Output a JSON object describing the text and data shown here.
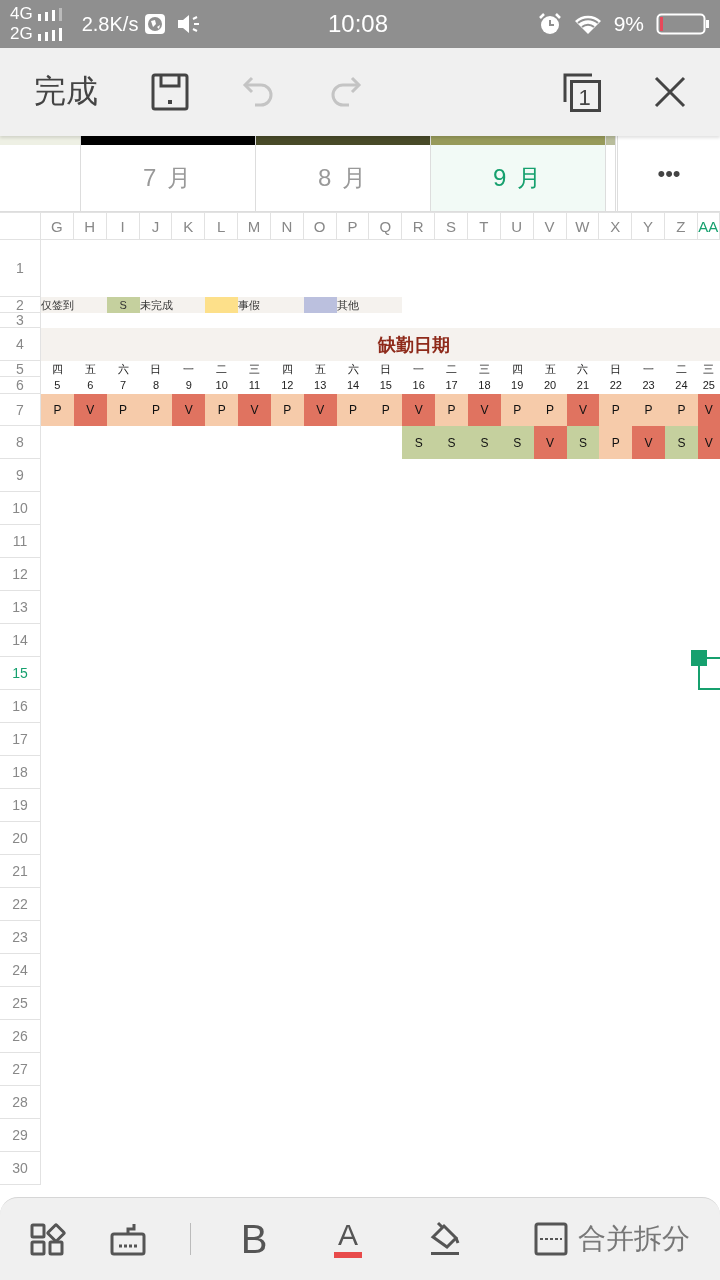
{
  "status_bar": {
    "network_top": "4G",
    "network_bottom": "2G",
    "speed": "2.8K/s",
    "time": "10:08",
    "battery": "9%"
  },
  "toolbar": {
    "done": "完成",
    "undo_disabled": true,
    "redo_disabled": true,
    "window_count": "1"
  },
  "sheet_tabs": [
    {
      "color": "#eef0e4",
      "selected": false
    },
    {
      "label": "7 月",
      "color": "#000000",
      "selected": false
    },
    {
      "label": "8 月",
      "color": "#484a28",
      "selected": false
    },
    {
      "label": "9 月",
      "color": "#979a5a",
      "selected": true
    },
    {
      "color": "#b9bd9c",
      "selected": false
    }
  ],
  "more_tabs": "•••",
  "sheet": {
    "columns": [
      {
        "label": "G",
        "selected": false,
        "weekday": "四",
        "day": "5",
        "row_7": {
          "text": "P",
          "color": "#f6cbaa"
        }
      },
      {
        "label": "H",
        "selected": false,
        "weekday": "五",
        "day": "6",
        "row_7": {
          "text": "V",
          "color": "#e07360"
        }
      },
      {
        "label": "I",
        "selected": false,
        "weekday": "六",
        "day": "7",
        "row_7": {
          "text": "P",
          "color": "#f6cbaa"
        }
      },
      {
        "label": "J",
        "selected": false,
        "weekday": "日",
        "day": "8",
        "row_7": {
          "text": "P",
          "color": "#f6cbaa"
        }
      },
      {
        "label": "K",
        "selected": false,
        "weekday": "一",
        "day": "9",
        "row_7": {
          "text": "V",
          "color": "#e07360"
        }
      },
      {
        "label": "L",
        "selected": false,
        "weekday": "二",
        "day": "10",
        "row_7": {
          "text": "P",
          "color": "#f6cbaa"
        }
      },
      {
        "label": "M",
        "selected": false,
        "weekday": "三",
        "day": "11",
        "row_7": {
          "text": "V",
          "color": "#e07360"
        }
      },
      {
        "label": "N",
        "selected": false,
        "weekday": "四",
        "day": "12",
        "row_7": {
          "text": "P",
          "color": "#f6cbaa"
        }
      },
      {
        "label": "O",
        "selected": false,
        "weekday": "五",
        "day": "13",
        "row_7": {
          "text": "V",
          "color": "#e07360"
        }
      },
      {
        "label": "P",
        "selected": false,
        "weekday": "六",
        "day": "14",
        "row_7": {
          "text": "P",
          "color": "#f6cbaa"
        }
      },
      {
        "label": "Q",
        "selected": false,
        "weekday": "日",
        "day": "15",
        "row_7": {
          "text": "P",
          "color": "#f6cbaa"
        }
      },
      {
        "label": "R",
        "selected": false,
        "weekday": "一",
        "day": "16",
        "row_7": {
          "text": "V",
          "color": "#e07360"
        },
        "row_8": {
          "text": "S",
          "color": "#c5d09e"
        }
      },
      {
        "label": "S",
        "selected": false,
        "weekday": "二",
        "day": "17",
        "row_7": {
          "text": "P",
          "color": "#f6cbaa"
        },
        "row_8": {
          "text": "S",
          "color": "#c5d09e"
        }
      },
      {
        "label": "T",
        "selected": false,
        "weekday": "三",
        "day": "18",
        "row_7": {
          "text": "V",
          "color": "#e07360"
        },
        "row_8": {
          "text": "S",
          "color": "#c5d09e"
        }
      },
      {
        "label": "U",
        "selected": false,
        "weekday": "四",
        "day": "19",
        "row_7": {
          "text": "P",
          "color": "#f6cbaa"
        },
        "row_8": {
          "text": "S",
          "color": "#c5d09e"
        }
      },
      {
        "label": "V",
        "selected": false,
        "weekday": "五",
        "day": "20",
        "row_7": {
          "text": "P",
          "color": "#f6cbaa"
        },
        "row_8": {
          "text": "V",
          "color": "#e07360"
        }
      },
      {
        "label": "W",
        "selected": false,
        "weekday": "六",
        "day": "21",
        "row_7": {
          "text": "V",
          "color": "#e07360"
        },
        "row_8": {
          "text": "S",
          "color": "#c5d09e"
        }
      },
      {
        "label": "X",
        "selected": false,
        "weekday": "日",
        "day": "22",
        "row_7": {
          "text": "P",
          "color": "#f6cbaa"
        },
        "row_8": {
          "text": "P",
          "color": "#f6cbaa"
        }
      },
      {
        "label": "Y",
        "selected": false,
        "weekday": "一",
        "day": "23",
        "row_7": {
          "text": "P",
          "color": "#f6cbaa"
        },
        "row_8": {
          "text": "V",
          "color": "#e07360"
        }
      },
      {
        "label": "Z",
        "selected": false,
        "weekday": "二",
        "day": "24",
        "row_7": {
          "text": "P",
          "color": "#f6cbaa"
        },
        "row_8": {
          "text": "S",
          "color": "#c5d09e"
        }
      },
      {
        "label": "AA",
        "selected": true,
        "weekday": "三",
        "day": "25",
        "row_7": {
          "text": "V",
          "color": "#e07360"
        },
        "row_8": {
          "text": "V",
          "color": "#e07360"
        }
      }
    ],
    "rows": [
      {
        "label": "1",
        "selected": false
      },
      {
        "label": "2",
        "selected": false
      },
      {
        "label": "3",
        "selected": false
      },
      {
        "label": "4",
        "selected": false
      },
      {
        "label": "5",
        "selected": false
      },
      {
        "label": "6",
        "selected": false
      },
      {
        "label": "7",
        "selected": false
      },
      {
        "label": "8",
        "selected": false
      },
      {
        "label": "9",
        "selected": false
      },
      {
        "label": "10",
        "selected": false
      },
      {
        "label": "11",
        "selected": false
      },
      {
        "label": "12",
        "selected": false
      },
      {
        "label": "13",
        "selected": false
      },
      {
        "label": "14",
        "selected": false
      },
      {
        "label": "15",
        "selected": true
      },
      {
        "label": "16",
        "selected": false
      },
      {
        "label": "17",
        "selected": false
      },
      {
        "label": "18",
        "selected": false
      },
      {
        "label": "19",
        "selected": false
      },
      {
        "label": "20",
        "selected": false
      },
      {
        "label": "21",
        "selected": false
      },
      {
        "label": "22",
        "selected": false
      },
      {
        "label": "23",
        "selected": false
      },
      {
        "label": "24",
        "selected": false
      },
      {
        "label": "25",
        "selected": false
      },
      {
        "label": "26",
        "selected": false
      },
      {
        "label": "27",
        "selected": false
      },
      {
        "label": "28",
        "selected": false
      },
      {
        "label": "29",
        "selected": false
      },
      {
        "label": "30",
        "selected": false
      }
    ],
    "legend": [
      {
        "kind": "text",
        "text": "仅签到"
      },
      {
        "kind": "swatch",
        "text": "S",
        "color": "#c5d09e"
      },
      {
        "kind": "text",
        "text": "未完成"
      },
      {
        "kind": "swatch",
        "color": "#fde08a"
      },
      {
        "kind": "text",
        "text": "事假"
      },
      {
        "kind": "swatch",
        "color": "#bbc0de"
      },
      {
        "kind": "text",
        "text": "其他"
      }
    ],
    "banner": "缺勤日期"
  },
  "bottom_toolbar": {
    "bold": "B",
    "font_color": "A",
    "merge": "合并拆分"
  }
}
